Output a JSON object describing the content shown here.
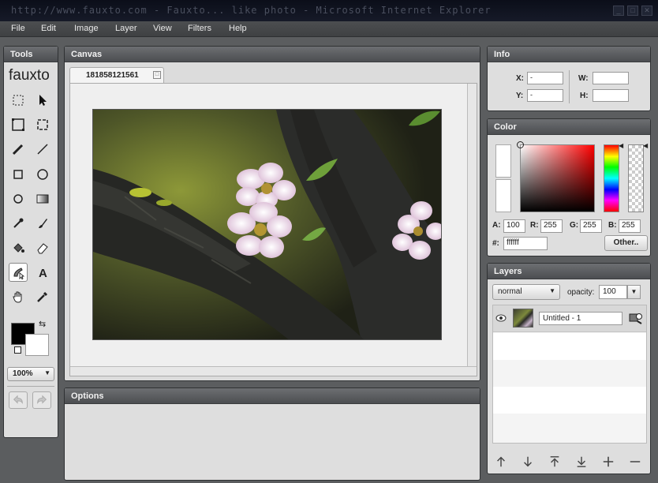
{
  "window": {
    "title": "http://www.fauxto.com - Fauxto... like photo - Microsoft Internet Explorer",
    "controls": [
      "_",
      "□",
      "✕"
    ]
  },
  "menu": [
    "File",
    "Edit",
    "Image",
    "Layer",
    "View",
    "Filters",
    "Help"
  ],
  "tools": {
    "title": "Tools",
    "logo": "fauxto",
    "zoom": "100%",
    "selected_tool": "smudge-tool",
    "foreground_color": "#000000",
    "background_color": "#ffffff"
  },
  "canvas": {
    "title": "Canvas",
    "tab_label": "181858121561",
    "tab_close": "□"
  },
  "options": {
    "title": "Options"
  },
  "info": {
    "title": "Info",
    "x_label": "X:",
    "y_label": "Y:",
    "w_label": "W:",
    "h_label": "H:",
    "x_value": "-",
    "y_value": "-",
    "w_value": "",
    "h_value": ""
  },
  "color": {
    "title": "Color",
    "a_label": "A:",
    "r_label": "R:",
    "g_label": "G:",
    "b_label": "B:",
    "hex_label": "#:",
    "a_value": "100",
    "r_value": "255",
    "g_value": "255",
    "b_value": "255",
    "hex_value": "ffffff",
    "other_label": "Other.."
  },
  "layers": {
    "title": "Layers",
    "blend_mode": "normal",
    "opacity_label": "opacity:",
    "opacity_value": "100",
    "items": [
      {
        "name": "Untitled - 1",
        "visible": true
      }
    ]
  }
}
